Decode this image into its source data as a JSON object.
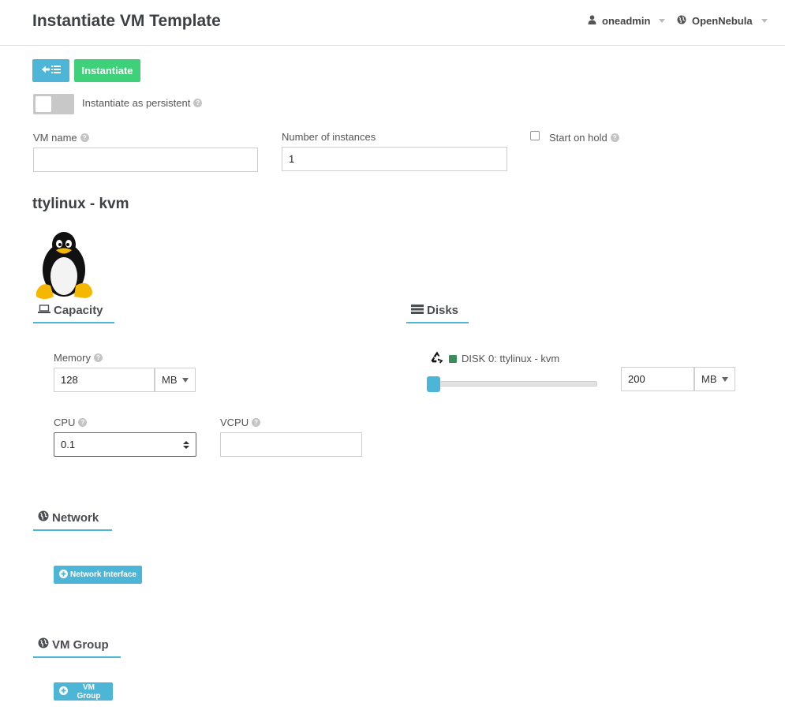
{
  "header": {
    "title": "Instantiate VM Template",
    "user": "oneadmin",
    "zone": "OpenNebula"
  },
  "actions": {
    "instantiate_label": "Instantiate"
  },
  "persistent": {
    "label": "Instantiate as persistent",
    "enabled": false
  },
  "form": {
    "vm_name_label": "VM name",
    "vm_name_value": "",
    "instances_label": "Number of instances",
    "instances_value": "1",
    "hold_label": "Start on hold",
    "hold_checked": false
  },
  "template": {
    "name": "ttylinux - kvm"
  },
  "capacity": {
    "title": "Capacity",
    "memory_label": "Memory",
    "memory_value": "128",
    "memory_unit": "MB",
    "cpu_label": "CPU",
    "cpu_value": "0.1",
    "vcpu_label": "VCPU",
    "vcpu_value": ""
  },
  "disks": {
    "title": "Disks",
    "disk_label": "DISK 0: ttylinux - kvm",
    "size_value": "200",
    "size_unit": "MB"
  },
  "network": {
    "title": "Network",
    "add_label": "Network Interface"
  },
  "vm_group": {
    "title": "VM Group",
    "add_label": "VM Group"
  },
  "colors": {
    "accent": "#4db6d6",
    "success": "#3fd17a",
    "disk": "#3b8e5b"
  }
}
